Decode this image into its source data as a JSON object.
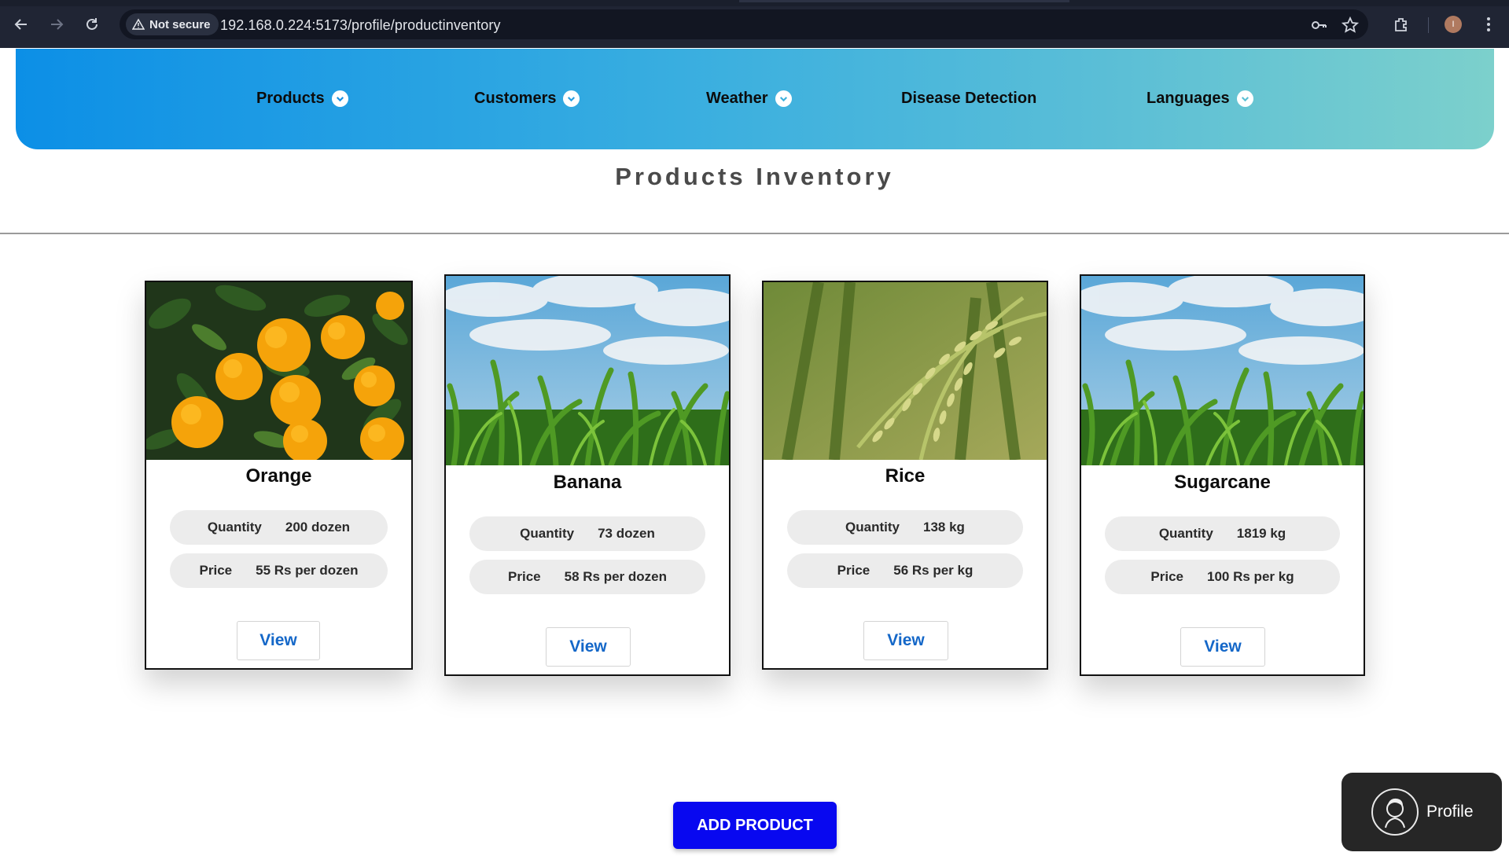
{
  "browser": {
    "security_label": "Not secure",
    "url": "192.168.0.224:5173/profile/productinventory",
    "profile_initial": "I"
  },
  "nav": {
    "items": [
      {
        "label": "Products",
        "dropdown": true
      },
      {
        "label": "Customers",
        "dropdown": true
      },
      {
        "label": "Weather",
        "dropdown": true
      },
      {
        "label": "Disease Detection",
        "dropdown": false
      },
      {
        "label": "Languages",
        "dropdown": true
      }
    ]
  },
  "page": {
    "title": "Products Inventory"
  },
  "products": [
    {
      "name": "Orange",
      "quantity_label": "Quantity",
      "quantity": "200 dozen",
      "price_label": "Price",
      "price": "55 Rs per dozen",
      "view_label": "View",
      "image": "orange-tree-photo"
    },
    {
      "name": "Banana",
      "quantity_label": "Quantity",
      "quantity": "73 dozen",
      "price_label": "Price",
      "price": "58 Rs per dozen",
      "view_label": "View",
      "image": "crop-field-sky-photo"
    },
    {
      "name": "Rice",
      "quantity_label": "Quantity",
      "quantity": "138 kg",
      "price_label": "Price",
      "price": "56 Rs per kg",
      "view_label": "View",
      "image": "rice-plant-photo"
    },
    {
      "name": "Sugarcane",
      "quantity_label": "Quantity",
      "quantity": "1819 kg",
      "price_label": "Price",
      "price": "100 Rs per kg",
      "view_label": "View",
      "image": "crop-field-sky-photo"
    }
  ],
  "actions": {
    "add_product_label": "ADD PRODUCT",
    "profile_label": "Profile"
  },
  "colors": {
    "nav_gradient_start": "#0c8fe6",
    "nav_gradient_end": "#7cd0cc",
    "add_button": "#0808f0",
    "view_text": "#1467c8"
  }
}
